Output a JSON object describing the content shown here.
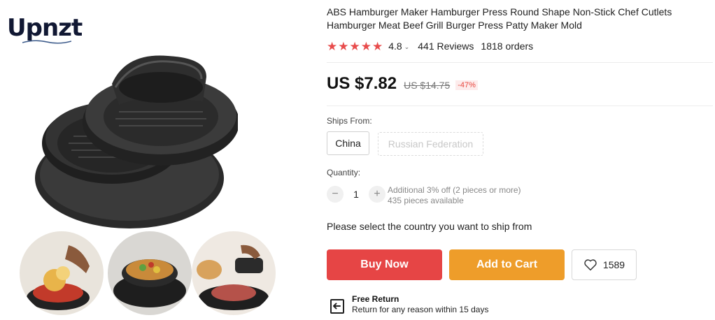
{
  "brand": {
    "logo_text": "Upnzt"
  },
  "product": {
    "title": "ABS Hamburger Maker Hamburger Press Round Shape Non-Stick Chef Cutlets Hamburger Meat Beef Grill Burger Press Patty Maker Mold",
    "rating": "4.8",
    "reviews": "441 Reviews",
    "orders": "1818 orders",
    "price": "US $7.82",
    "old_price": "US $14.75",
    "discount": "-47%"
  },
  "shipping": {
    "label": "Ships From:",
    "options": [
      "China",
      "Russian Federation"
    ]
  },
  "quantity": {
    "label": "Quantity:",
    "value": "1",
    "minus": "−",
    "plus": "+",
    "offer": "Additional 3% off (2 pieces or more)",
    "available": "435 pieces available"
  },
  "notice": "Please select the country you want to ship from",
  "actions": {
    "buy_now": "Buy Now",
    "add_to_cart": "Add to Cart",
    "wishlist_count": "1589"
  },
  "return_policy": {
    "title": "Free Return",
    "subtitle": "Return for any reason within 15 days"
  },
  "colors": {
    "star": "#e84c4c",
    "buy_now": "#e64545",
    "add_to_cart": "#ee9d2a",
    "discount": "#e8483f"
  },
  "icons": [
    "star-icon",
    "chevron-down-icon",
    "heart-icon",
    "return-icon"
  ]
}
